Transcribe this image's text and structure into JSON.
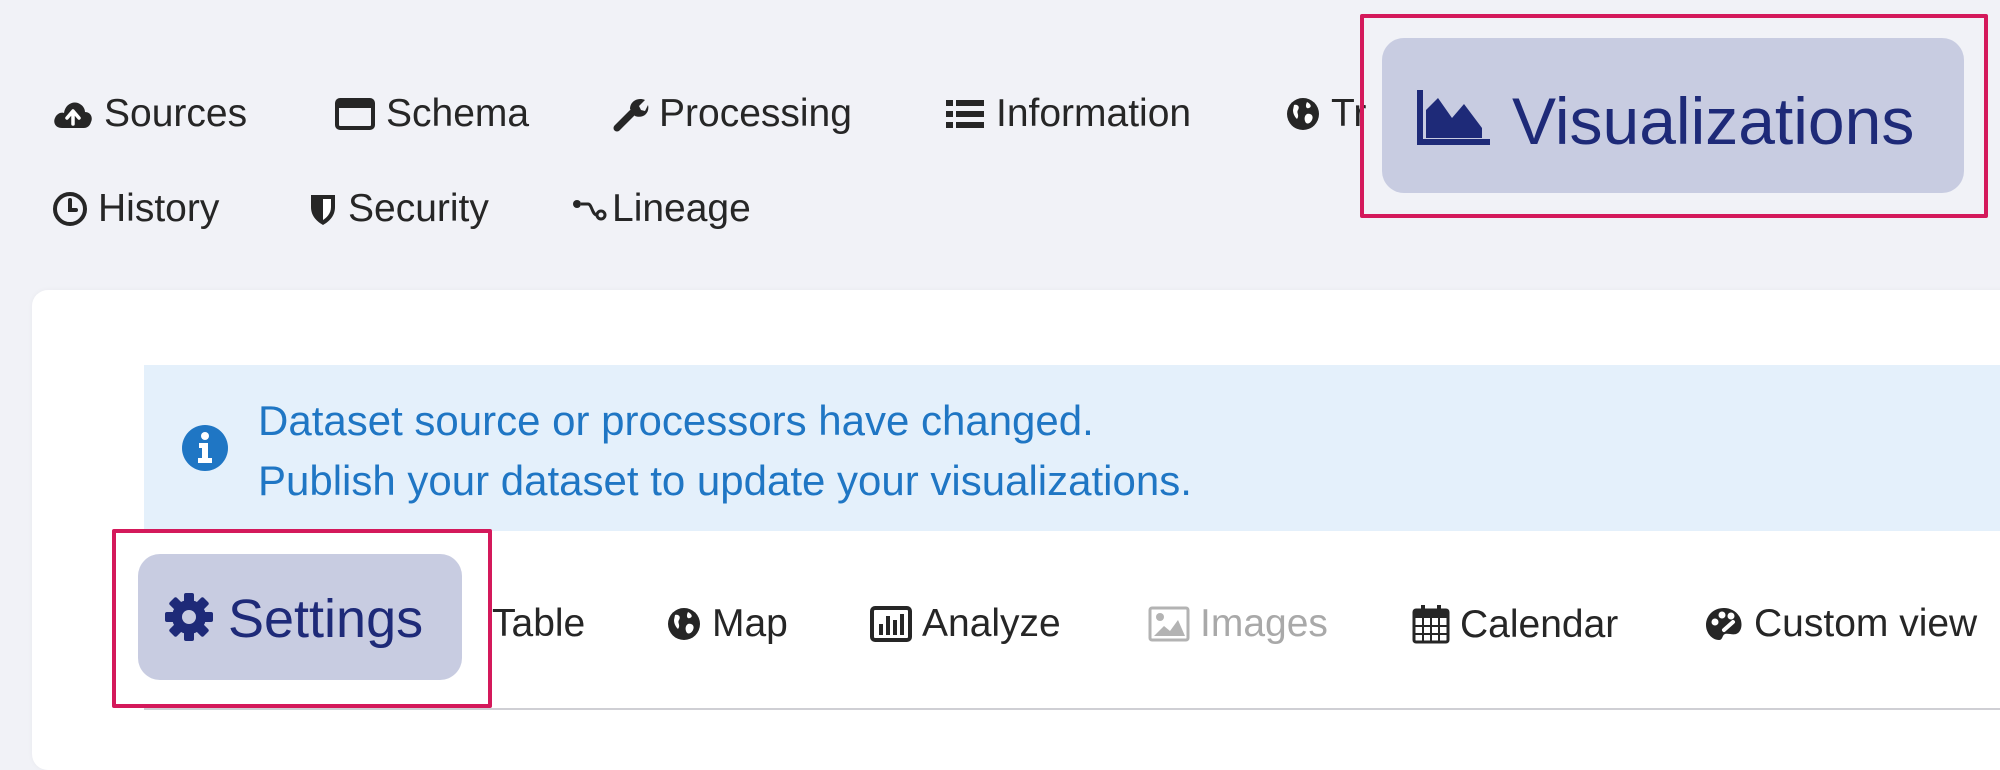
{
  "top_nav": {
    "row1": [
      {
        "label": "Sources",
        "icon": "cloud-upload-icon"
      },
      {
        "label": "Schema",
        "icon": "window-icon"
      },
      {
        "label": "Processing",
        "icon": "wrench-icon"
      },
      {
        "label": "Information",
        "icon": "list-icon"
      },
      {
        "label": "Tr",
        "icon": "globe-icon"
      }
    ],
    "row2": [
      {
        "label": "History",
        "icon": "clock-icon"
      },
      {
        "label": "Security",
        "icon": "shield-icon"
      },
      {
        "label": "Lineage",
        "icon": "lineage-icon"
      }
    ],
    "active": {
      "label": "Visualizations",
      "icon": "area-chart-icon"
    }
  },
  "alert": {
    "icon": "info-icon",
    "line1": "Dataset source or processors have changed.",
    "line2": "Publish your dataset to update your visualizations.",
    "color": "#1f76c4"
  },
  "viz_tabs": {
    "active": {
      "label": "Settings",
      "icon": "gear-icon"
    },
    "items": [
      {
        "label": "Table",
        "icon": ""
      },
      {
        "label": "Map",
        "icon": "globe-icon"
      },
      {
        "label": "Analyze",
        "icon": "bar-chart-icon"
      },
      {
        "label": "Images",
        "icon": "image-icon",
        "disabled": true
      },
      {
        "label": "Calendar",
        "icon": "calendar-icon"
      },
      {
        "label": "Custom view",
        "icon": "palette-icon"
      }
    ]
  },
  "colors": {
    "highlight_border": "#d4195b",
    "active_pill_bg": "#c8cce1",
    "active_text": "#1e2a78",
    "page_bg": "#f1f2f7",
    "alert_bg": "#e4f0fb",
    "disabled_text": "#a9a9a9"
  }
}
